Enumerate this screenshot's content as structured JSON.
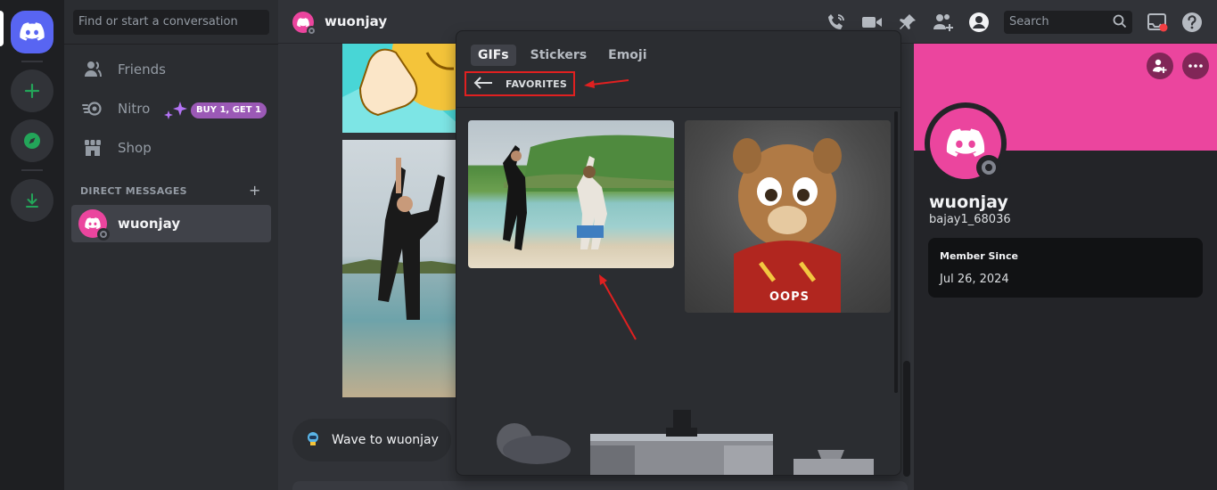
{
  "sidebar": {
    "search_placeholder": "Find or start a conversation",
    "nav": [
      {
        "label": "Friends",
        "icon": "friends-icon"
      },
      {
        "label": "Nitro",
        "icon": "nitro-icon"
      },
      {
        "label": "Shop",
        "icon": "shop-icon"
      }
    ],
    "nitro_badge": "BUY 1, GET 1",
    "dm_header": "DIRECT MESSAGES",
    "dm_add": "+",
    "dms": [
      {
        "name": "wuonjay"
      }
    ]
  },
  "header": {
    "name": "wuonjay",
    "search_placeholder": "Search"
  },
  "chat": {
    "wave_label": "Wave to wuonjay"
  },
  "picker": {
    "tabs": [
      "GIFs",
      "Stickers",
      "Emoji"
    ],
    "active_tab": "GIFs",
    "section": "FAVORITES",
    "gif_caption": "OOPS"
  },
  "profile": {
    "name": "wuonjay",
    "tag": "bajay1_68036",
    "member_since_label": "Member Since",
    "member_since_date": "Jul 26, 2024"
  },
  "colors": {
    "brand": "#5865f2",
    "avatar_pink": "#eb459e",
    "highlight_red": "#e02020"
  }
}
